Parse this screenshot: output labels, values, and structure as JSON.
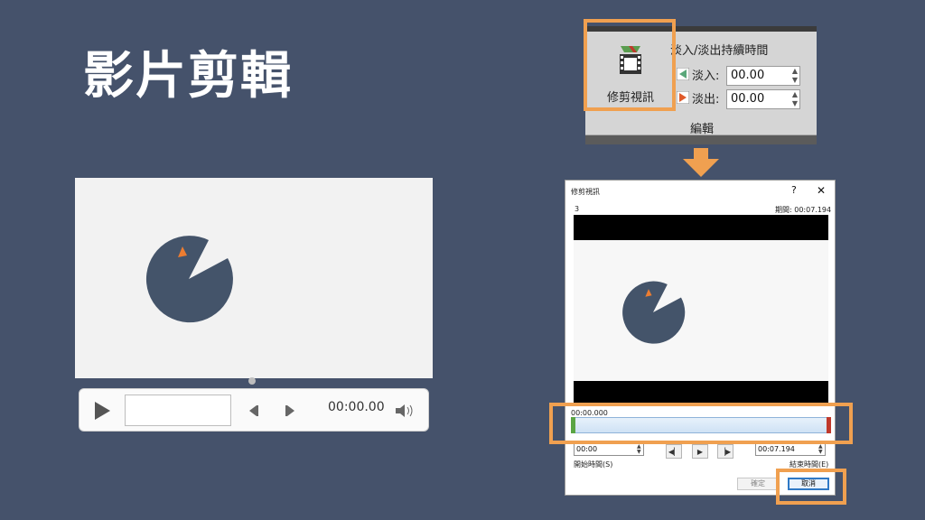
{
  "slide": {
    "title": "影片剪輯"
  },
  "player": {
    "time": "00:00.00",
    "icons": [
      "play-icon",
      "previous-frame-icon",
      "next-frame-icon",
      "volume-icon"
    ]
  },
  "ribbon": {
    "trim_video_label": "修剪視訊",
    "fade_duration_label": "淡入/淡出持續時間",
    "fade_in_label": "淡入:",
    "fade_in_value": "00.00",
    "fade_out_label": "淡出:",
    "fade_out_value": "00.00",
    "group_label": "編輯"
  },
  "dialog": {
    "title": "修剪視訊",
    "help": "?",
    "close": "✕",
    "index": "3",
    "duration": "期間: 00:07.194",
    "timeline_start_time": "00:00.000",
    "start_time_value": "00:00",
    "start_time_label": "開始時間(S)",
    "end_time_value": "00:07.194",
    "end_time_label": "結束時間(E)",
    "ok_label": "確定",
    "cancel_label": "取消"
  },
  "colors": {
    "background": "#45526b",
    "pie": "#44546a",
    "pie_accent": "#ed7d31",
    "highlight": "#f0a050",
    "accent_blue": "#2f79c6"
  }
}
